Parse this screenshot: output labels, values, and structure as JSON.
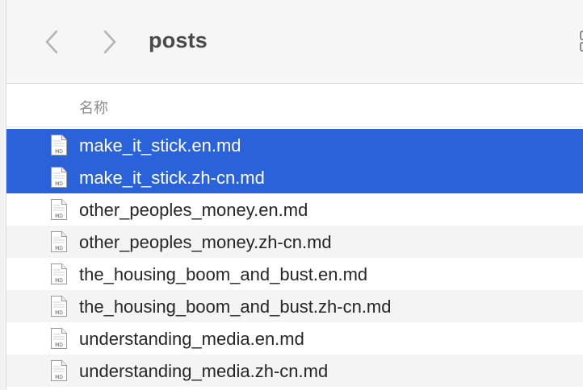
{
  "window": {
    "folder_title": "posts"
  },
  "toolbar": {
    "back_icon": "chevron-left-icon",
    "forward_icon": "chevron-right-icon",
    "view_icon": "grid-view-icon"
  },
  "list_header": {
    "name_column": "名称"
  },
  "files": [
    {
      "name": "make_it_stick.en.md",
      "icon": "markdown-file-icon",
      "icon_label": "MD",
      "selected": true
    },
    {
      "name": "make_it_stick.zh-cn.md",
      "icon": "markdown-file-icon",
      "icon_label": "MD",
      "selected": true
    },
    {
      "name": "other_peoples_money.en.md",
      "icon": "markdown-file-icon",
      "icon_label": "MD",
      "selected": false
    },
    {
      "name": "other_peoples_money.zh-cn.md",
      "icon": "markdown-file-icon",
      "icon_label": "MD",
      "selected": false
    },
    {
      "name": "the_housing_boom_and_bust.en.md",
      "icon": "markdown-file-icon",
      "icon_label": "MD",
      "selected": false
    },
    {
      "name": "the_housing_boom_and_bust.zh-cn.md",
      "icon": "markdown-file-icon",
      "icon_label": "MD",
      "selected": false
    },
    {
      "name": "understanding_media.en.md",
      "icon": "markdown-file-icon",
      "icon_label": "MD",
      "selected": false
    },
    {
      "name": "understanding_media.zh-cn.md",
      "icon": "markdown-file-icon",
      "icon_label": "MD",
      "selected": false
    }
  ],
  "colors": {
    "selection": "#2a63d9",
    "alt_row": "#f4f4f4",
    "text": "#262626",
    "title": "#4a4a4a"
  }
}
